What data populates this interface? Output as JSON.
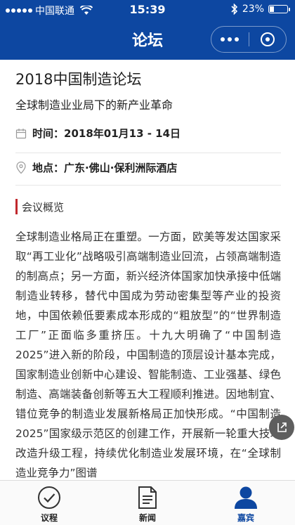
{
  "status_bar": {
    "carrier": "中国联通",
    "time": "15:39",
    "battery": "23%",
    "battery_level": 0.23
  },
  "nav": {
    "title": "论坛"
  },
  "conference": {
    "title": "2018中国制造论坛",
    "subtitle": "全球制造业业局下的新产业革命",
    "time_label": "时间：",
    "time_value": "2018年01月13 - 14日",
    "place_label": "地点：",
    "place_value": "广东·佛山·保利洲际酒店"
  },
  "overview": {
    "heading": "会议概览",
    "text": "全球制造业格局正在重塑。一方面，欧美等发达国家采取“再工业化”战略吸引高端制造业回流，占领高端制造的制高点；另一方面，新兴经济体国家加快承接中低端制造业转移，替代中国成为劳动密集型等产业的投资地，中国依赖低要素成本形成的“粗放型”的“世界制造工厂”正面临多重挤压。十九大明确了“中国制造2025”进入新的阶段，中国制造的顶层设计基本完成，国家制造业创新中心建设、智能制造、工业强基、绿色制造、高端装备创新等五大工程顺利推进。因地制宜、错位竞争的制造业发展新格局正加快形成。“中国制造2025”国家级示范区的创建工作，开展新一轮重大技术改造升级工程，持续优化制造业发展环境，在“全球制造业竞争力”图谱"
  },
  "tabs": [
    {
      "label": "议程",
      "icon": "check-circle-icon"
    },
    {
      "label": "新闻",
      "icon": "document-icon"
    },
    {
      "label": "嘉宾",
      "icon": "person-icon"
    }
  ],
  "colors": {
    "primary": "#0d47a1",
    "section_accent": "#c0282d",
    "text": "#333333"
  }
}
